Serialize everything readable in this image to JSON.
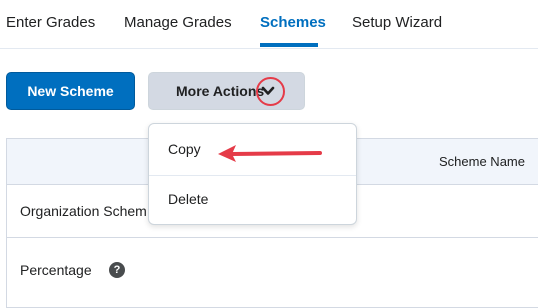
{
  "tabs": {
    "enter_grades": "Enter Grades",
    "manage_grades": "Manage Grades",
    "schemes": "Schemes",
    "setup_wizard": "Setup Wizard"
  },
  "toolbar": {
    "new_scheme_label": "New Scheme",
    "more_actions_label": "More Actions"
  },
  "menu": {
    "items": [
      {
        "label": "Copy"
      },
      {
        "label": "Delete"
      }
    ]
  },
  "table": {
    "header_scheme_name": "Scheme Name",
    "rows": [
      {
        "name": "Organization Schem"
      },
      {
        "name": "Percentage"
      }
    ]
  },
  "icons": {
    "chevron": "chevron-down-icon",
    "help": "help-icon",
    "help_glyph": "?"
  },
  "colors": {
    "accent": "#006fbf",
    "annotation": "#e53b48"
  }
}
